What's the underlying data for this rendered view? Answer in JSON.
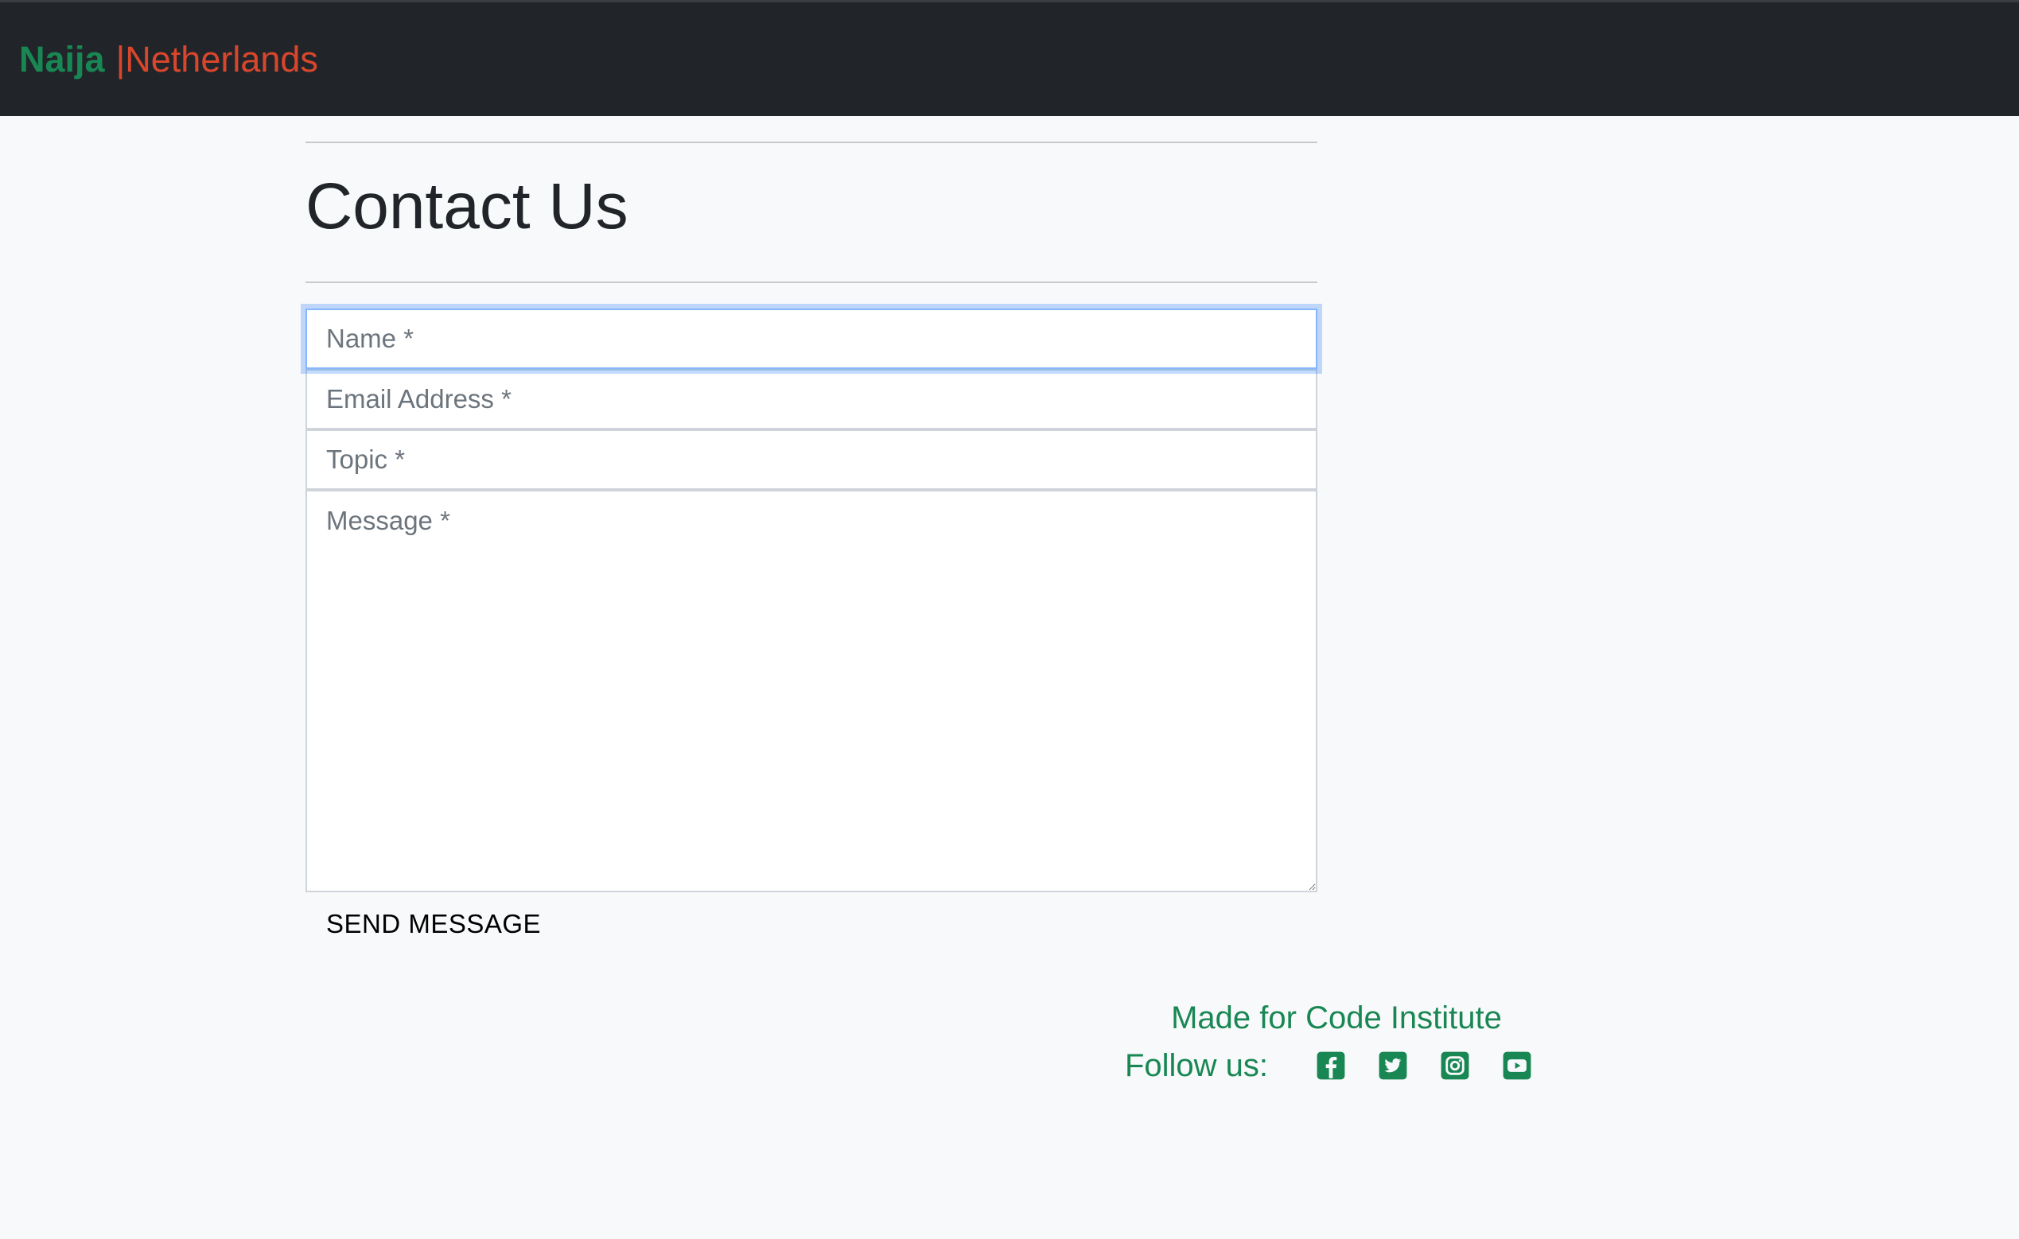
{
  "navbar": {
    "brand_main": "Naija",
    "brand_separator": "|",
    "brand_sub": "Netherlands"
  },
  "page": {
    "title": "Contact Us"
  },
  "form": {
    "name_placeholder": "Name *",
    "email_placeholder": "Email Address *",
    "topic_placeholder": "Topic *",
    "message_placeholder": "Message *",
    "send_label": "SEND MESSAGE"
  },
  "footer": {
    "made_for": "Made for Code Institute",
    "follow_label": "Follow us:",
    "social_icons": [
      "facebook-icon",
      "twitter-icon",
      "instagram-icon",
      "youtube-icon"
    ]
  },
  "colors": {
    "navbar_bg": "#212529",
    "brand_green": "#198754",
    "brand_orange": "#d9462b",
    "page_bg": "#f8f9fa",
    "focus_border": "#86b7fe"
  }
}
